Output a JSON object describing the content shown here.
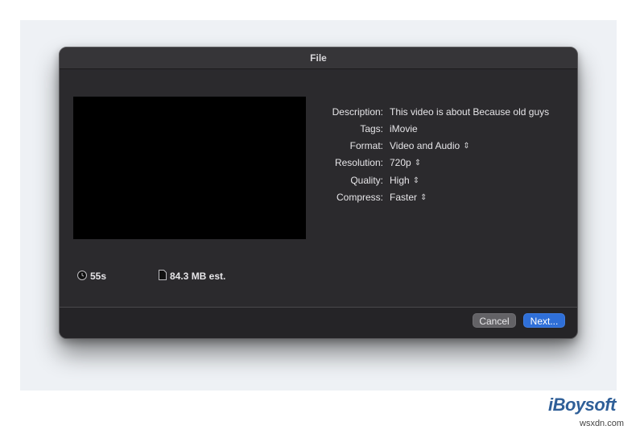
{
  "window": {
    "title": "File"
  },
  "details": {
    "description_label": "Description:",
    "description_value": "This video is about Because old guys",
    "tags_label": "Tags:",
    "tags_value": "iMovie",
    "format_label": "Format:",
    "format_value": "Video and Audio",
    "resolution_label": "Resolution:",
    "resolution_value": "720p",
    "quality_label": "Quality:",
    "quality_value": "High",
    "compress_label": "Compress:",
    "compress_value": "Faster"
  },
  "stats": {
    "duration": "55s",
    "size": "84.3 MB est."
  },
  "buttons": {
    "cancel": "Cancel",
    "next": "Next..."
  },
  "branding": {
    "logo": "iBoysoft",
    "watermark": "wsxdn.com"
  },
  "colors": {
    "dialog_bg": "#2b2a2d",
    "accent": "#2f6fd8",
    "brand": "#2f5f98"
  },
  "icons": {
    "duration": "clock-icon",
    "size": "document-icon",
    "popup": "updown-chevron-icon"
  }
}
